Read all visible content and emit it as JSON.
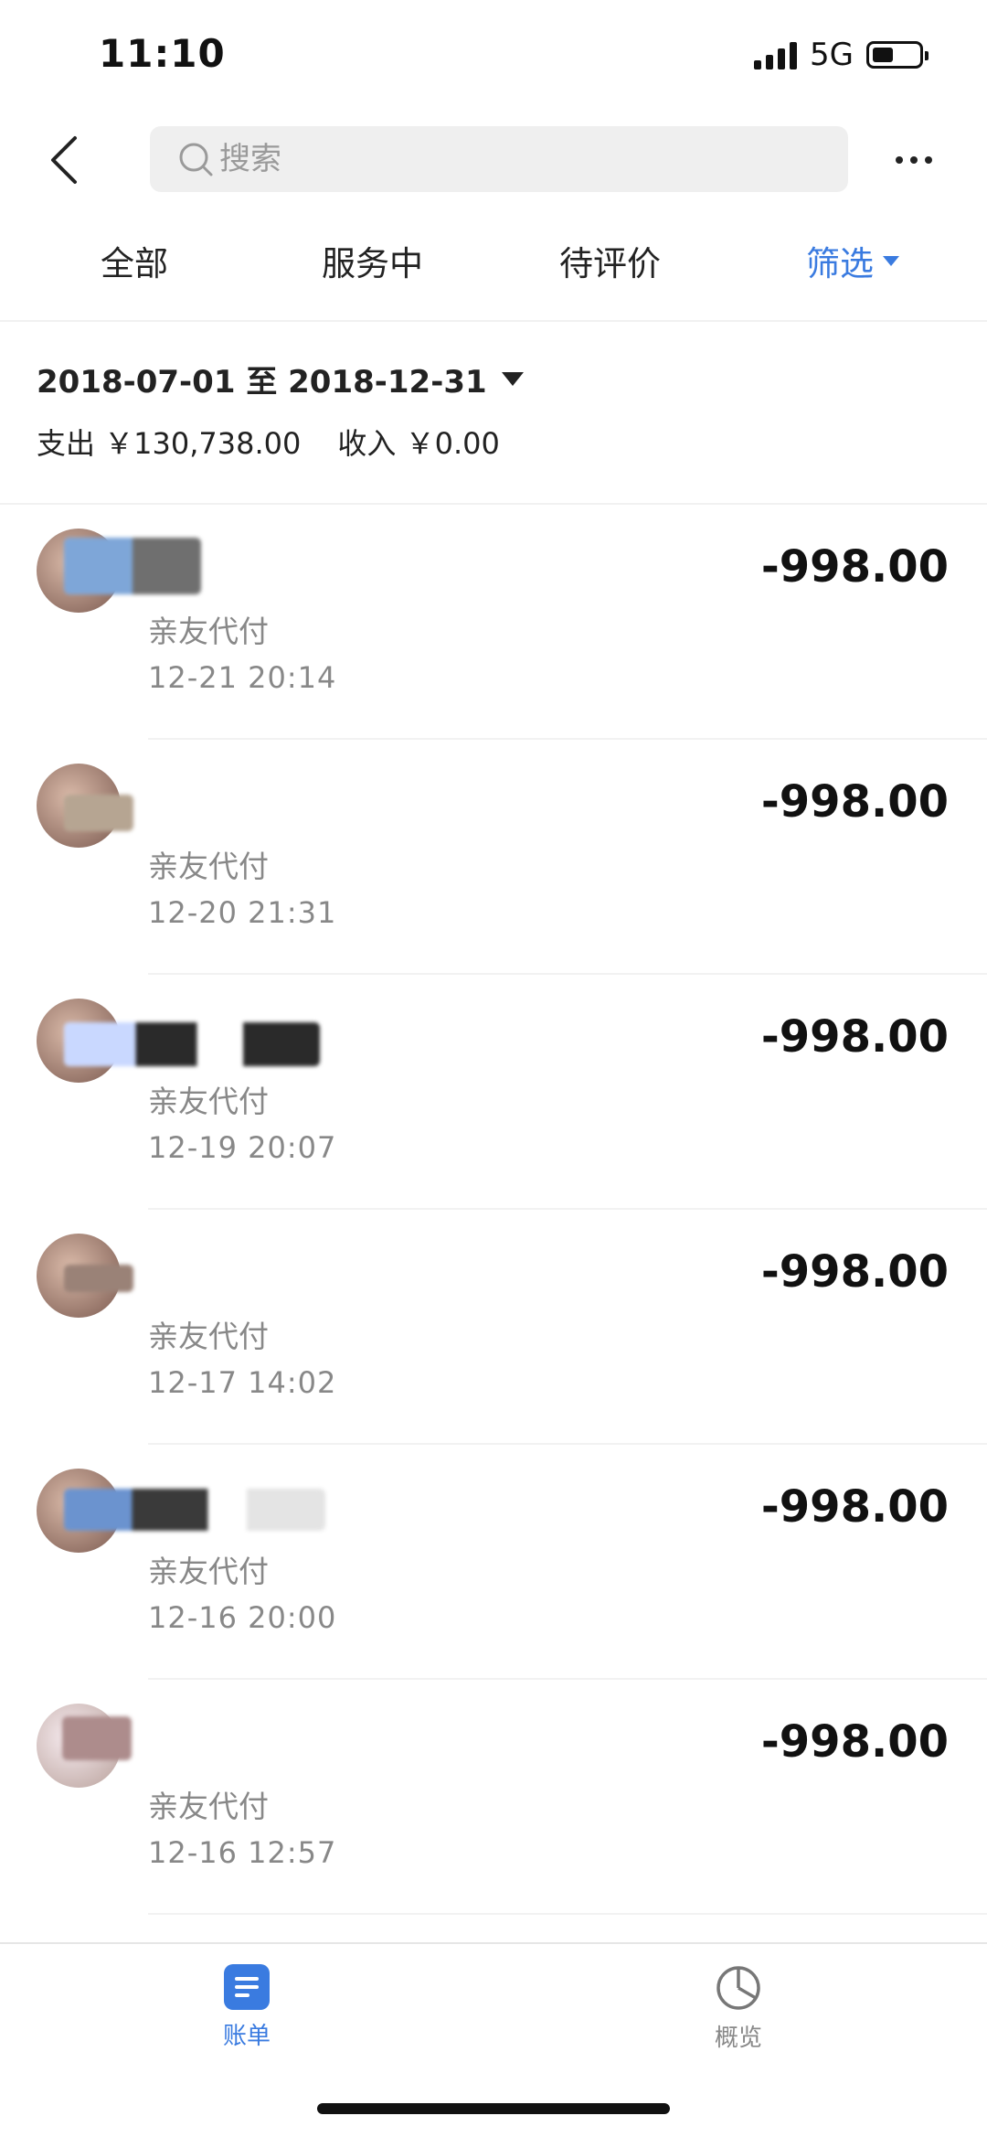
{
  "status_bar": {
    "time": "11:10",
    "network": "5G",
    "battery_level": 0.35
  },
  "header": {
    "search_placeholder": "搜索"
  },
  "tabs": [
    {
      "label": "全部"
    },
    {
      "label": "服务中"
    },
    {
      "label": "待评价"
    },
    {
      "label": "筛选"
    }
  ],
  "summary": {
    "date_range": "2018-07-01 至 2018-12-31",
    "expense": "支出 ￥130,738.00",
    "income": "收入 ￥0.00"
  },
  "transactions": [
    {
      "type": "亲友代付",
      "time": "12-21  20:14",
      "amount": "-998.00"
    },
    {
      "type": "亲友代付",
      "time": "12-20  21:31",
      "amount": "-998.00"
    },
    {
      "type": "亲友代付",
      "time": "12-19  20:07",
      "amount": "-998.00"
    },
    {
      "type": "亲友代付",
      "time": "12-17  14:02",
      "amount": "-998.00"
    },
    {
      "type": "亲友代付",
      "time": "12-16  20:00",
      "amount": "-998.00"
    },
    {
      "type": "亲友代付",
      "time": "12-16  12:57",
      "amount": "-998.00"
    }
  ],
  "bottom_nav": [
    {
      "label": "账单",
      "icon": "bill-icon",
      "active": true
    },
    {
      "label": "概览",
      "icon": "pie-chart-icon",
      "active": false
    }
  ],
  "colors": {
    "accent": "#3a7be0",
    "secondary_text": "#888888"
  }
}
